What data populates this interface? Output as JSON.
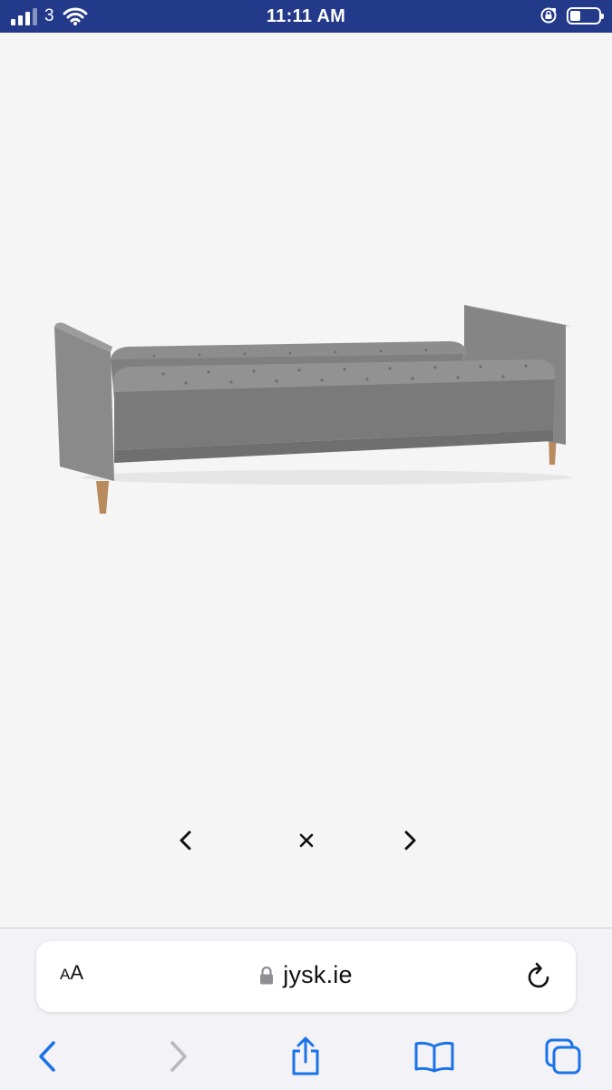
{
  "status_bar": {
    "carrier": "3",
    "time": "11:11 AM",
    "background": "#23398a"
  },
  "product": {
    "image_icon": "sofa-bed-image"
  },
  "gallery": {
    "prev_icon": "chevron-left-icon",
    "close_icon": "close-icon",
    "next_icon": "chevron-right-icon"
  },
  "browser": {
    "text_size_label_small": "A",
    "text_size_label_large": "A",
    "url": "jysk.ie",
    "accent": "#1a73e8"
  },
  "toolbar": {
    "back_icon": "back-icon",
    "forward_icon": "forward-icon",
    "share_icon": "share-icon",
    "bookmarks_icon": "bookmarks-icon",
    "tabs_icon": "tabs-icon"
  }
}
